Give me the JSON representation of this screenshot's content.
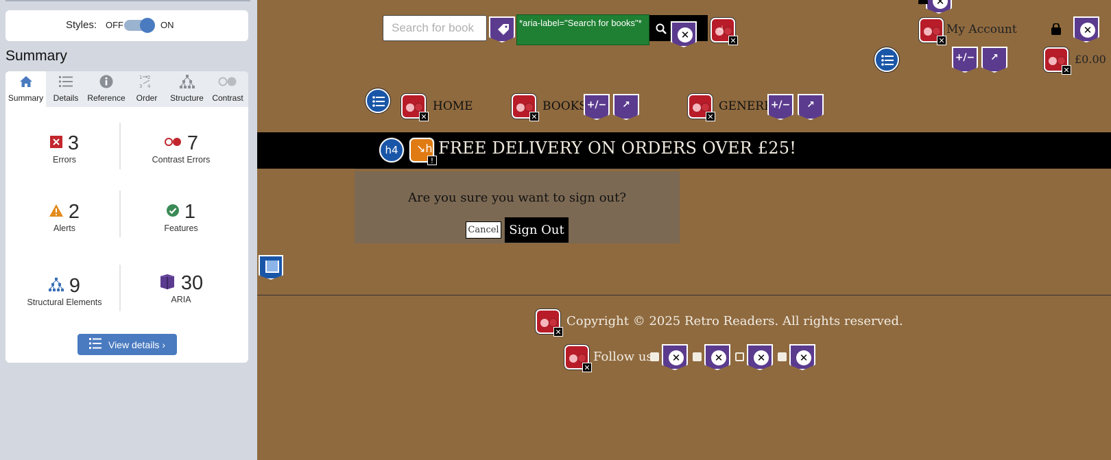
{
  "wave": {
    "styles": {
      "label": "Styles:",
      "off": "OFF",
      "on": "ON"
    },
    "summary_heading": "Summary",
    "tabs": [
      {
        "label": "Summary",
        "icon": "home-icon"
      },
      {
        "label": "Details",
        "icon": "list-icon"
      },
      {
        "label": "Reference",
        "icon": "info-icon"
      },
      {
        "label": "Order",
        "icon": "order-icon"
      },
      {
        "label": "Structure",
        "icon": "structure-icon"
      },
      {
        "label": "Contrast",
        "icon": "contrast-icon"
      }
    ],
    "stats": {
      "errors": {
        "count": "3",
        "label": "Errors"
      },
      "contrast": {
        "count": "7",
        "label": "Contrast Errors"
      },
      "alerts": {
        "count": "2",
        "label": "Alerts"
      },
      "features": {
        "count": "1",
        "label": "Features"
      },
      "structural": {
        "count": "9",
        "label": "Structural Elements"
      },
      "aria": {
        "count": "30",
        "label": "ARIA"
      }
    },
    "view_details": "View details ›",
    "colors": {
      "accent": "#4a7bc0",
      "error": "#c2272d",
      "alert": "#e38b1c",
      "feature": "#3a8a55",
      "aria": "#5b3b8e"
    }
  },
  "site": {
    "search_placeholder": "Search for book",
    "aria_tooltip": "*aria-label=\"Search for books\"*",
    "my_account": "My Account",
    "cart_total": "£0.00",
    "nav": {
      "home": "HOME",
      "books": "BOOKS",
      "genere": "GENERE"
    },
    "banner": "FREE DELIVERY ON ORDERS OVER £25!",
    "heading_badge": "h4",
    "signout_question": "Are you sure you want to sign out?",
    "cancel": "Cancel",
    "sign_out": "Sign Out",
    "copyright": "Copyright © 2025 Retro Readers. All rights reserved.",
    "follow_us": "Follow us:",
    "colors": {
      "background": "#8f6a3f",
      "banner": "#000000",
      "modal": "#7c6953"
    }
  }
}
